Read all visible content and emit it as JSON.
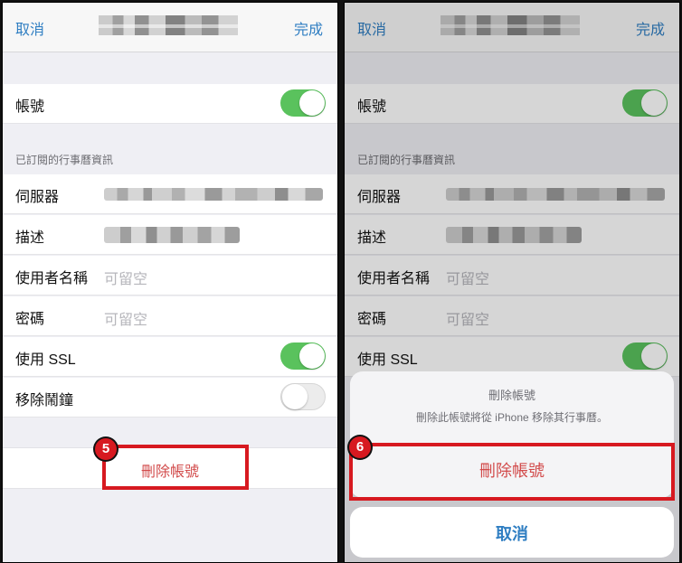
{
  "left_panel": {
    "nav": {
      "cancel": "取消",
      "done": "完成"
    },
    "rows": {
      "account": "帳號",
      "section_title": "已訂閱的行事曆資訊",
      "server": "伺服器",
      "description": "描述",
      "username": "使用者名稱",
      "username_placeholder": "可留空",
      "password": "密碼",
      "password_placeholder": "可留空",
      "use_ssl": "使用 SSL",
      "remove_alarm": "移除鬧鐘"
    },
    "delete_account": "刪除帳號",
    "callout_number": "5"
  },
  "right_panel": {
    "nav": {
      "cancel": "取消",
      "done": "完成"
    },
    "rows": {
      "account": "帳號",
      "section_title": "已訂閱的行事曆資訊",
      "server": "伺服器",
      "description": "描述",
      "username": "使用者名稱",
      "username_placeholder": "可留空",
      "password": "密碼",
      "password_placeholder": "可留空",
      "use_ssl": "使用 SSL"
    },
    "action_sheet": {
      "title": "刪除帳號",
      "message": "刪除此帳號將從 iPhone 移除其行事曆。",
      "delete_button": "刪除帳號",
      "cancel_button": "取消"
    },
    "callout_number": "6"
  },
  "toggles": {
    "left_account": true,
    "left_ssl": true,
    "left_alarm": false,
    "right_account": true,
    "right_ssl": true
  },
  "colors": {
    "accent": "#2f7ec2",
    "toggle_on": "#5ac25d",
    "destructive": "#d24b4b",
    "callout": "#d71920"
  }
}
